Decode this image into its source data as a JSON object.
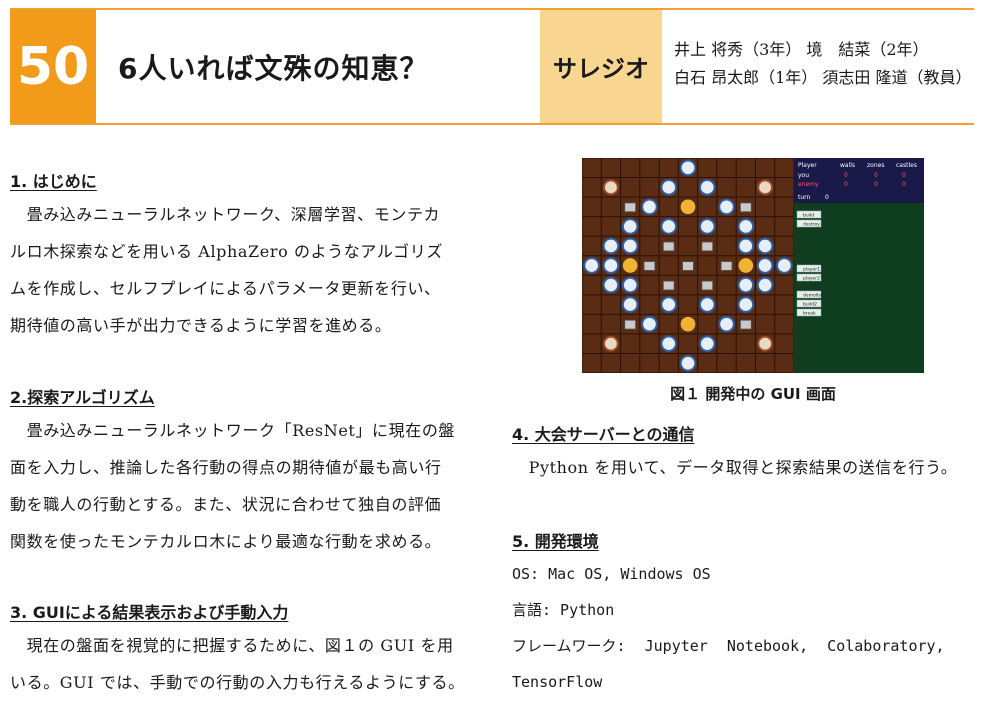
{
  "header": {
    "number": "50",
    "title": "6人いれば文殊の知恵？",
    "school": "サレジオ",
    "authors": [
      "井上 将秀（3年） 境　結菜（2年）",
      "白石 昂太郎（1年） 須志田 隆道（教員）"
    ]
  },
  "sections": {
    "s1": {
      "heading": "1. はじめに",
      "lines": [
        "　畳み込みニューラルネットワーク、深層学習、モンテカ",
        "ルロ木探索などを用いる AlphaZero のようなアルゴリズ",
        "ムを作成し、セルフプレイによるパラメータ更新を行い、",
        "期待値の高い手が出力できるように学習を進める。"
      ]
    },
    "s2": {
      "heading": "2.探索アルゴリズム",
      "lines": [
        "　畳み込みニューラルネットワーク「ResNet」に現在の盤",
        "面を入力し、推論した各行動の得点の期待値が最も高い行",
        "動を職人の行動とする。また、状況に合わせて独自の評価",
        "関数を使ったモンテカルロ木により最適な行動を求める。"
      ]
    },
    "s3": {
      "heading": "3. GUIによる結果表示および手動入力",
      "lines": [
        "　現在の盤面を視覚的に把握するために、図１の GUI を用",
        "いる。GUI では、手動での行動の入力も行えるようにする。"
      ]
    },
    "s4": {
      "heading": "4. 大会サーバーとの通信",
      "lines": [
        "　Python を用いて、データ取得と探索結果の送信を行う。"
      ]
    },
    "s5": {
      "heading": "5. 開発環境",
      "lines": [
        "OS: Mac OS, Windows OS",
        "言語: Python",
        "フレームワーク: Jupyter Notebook, Colaboratory,",
        "TensorFlow"
      ]
    }
  },
  "figure": {
    "caption": "図１ 開発中の GUI 画面",
    "panel": {
      "headers": [
        "Player",
        "walls",
        "zones",
        "castles"
      ],
      "rows": [
        {
          "name": "you",
          "values": [
            "0",
            "0",
            "0"
          ]
        },
        {
          "name": "enemy",
          "values": [
            "0",
            "0",
            "0"
          ]
        }
      ],
      "turn_label": "turn",
      "turn_value": "0",
      "checks_a": [
        "build",
        "destroy"
      ],
      "checks_b": [
        "player1",
        "player2"
      ],
      "checks_c": [
        "demolish",
        "build2",
        "break"
      ]
    },
    "colors": {
      "board": "#5a2c14",
      "panel": "#0f3d1f",
      "header": "#1a1a4a"
    }
  }
}
